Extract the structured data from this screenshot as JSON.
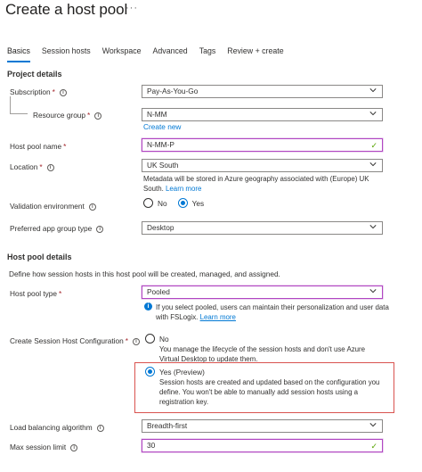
{
  "page": {
    "title": "Create a host pool",
    "more": "···"
  },
  "tabs": [
    "Basics",
    "Session hosts",
    "Workspace",
    "Advanced",
    "Tags",
    "Review + create"
  ],
  "project": {
    "heading": "Project details",
    "subscription_label": "Subscription",
    "subscription_value": "Pay-As-You-Go",
    "resource_group_label": "Resource group",
    "resource_group_value": "N-MM",
    "create_new": "Create new"
  },
  "host_pool_name": {
    "label": "Host pool name",
    "value": "N-MM-P"
  },
  "location": {
    "label": "Location",
    "value": "UK South",
    "help_line1": "Metadata will be stored in Azure geography associated with (Europe) UK",
    "help_line2_text": "South.",
    "learn_more": "Learn more"
  },
  "validation": {
    "label": "Validation environment",
    "no": "No",
    "yes": "Yes",
    "selected": "Yes"
  },
  "app_group": {
    "label": "Preferred app group type",
    "value": "Desktop"
  },
  "host_pool_details": {
    "heading": "Host pool details",
    "description": "Define how session hosts in this host pool will be created, managed, and assigned."
  },
  "host_pool_type": {
    "label": "Host pool type",
    "value": "Pooled",
    "info_line1": "If you select pooled, users can maintain their personalization and user data",
    "info_line2_text": "with FSLogix.",
    "learn_more": "Learn more"
  },
  "session_host_config": {
    "label": "Create Session Host Configuration",
    "no_label": "No",
    "no_desc_line1": "You manage the lifecycle of the session hosts and don't use Azure",
    "no_desc_line2": "Virtual Desktop to update them.",
    "yes_label": "Yes (Preview)",
    "yes_desc_line1": "Session hosts are created and updated based on the configuration you",
    "yes_desc_line2": "define. You won't be able to manually add session hosts using a",
    "yes_desc_line3": "registration key.",
    "selected": "Yes (Preview)"
  },
  "load_balancing": {
    "label": "Load balancing algorithm",
    "value": "Breadth-first"
  },
  "max_session": {
    "label": "Max session limit",
    "value": "30"
  },
  "colors": {
    "accent": "#0078d4",
    "required": "#a4262c",
    "valid_border": "#b146c2",
    "highlight": "#d9534f",
    "check": "#57a300"
  },
  "icons": [
    "info-icon",
    "chevron-down-icon",
    "checkmark-icon",
    "info-filled-icon"
  ]
}
